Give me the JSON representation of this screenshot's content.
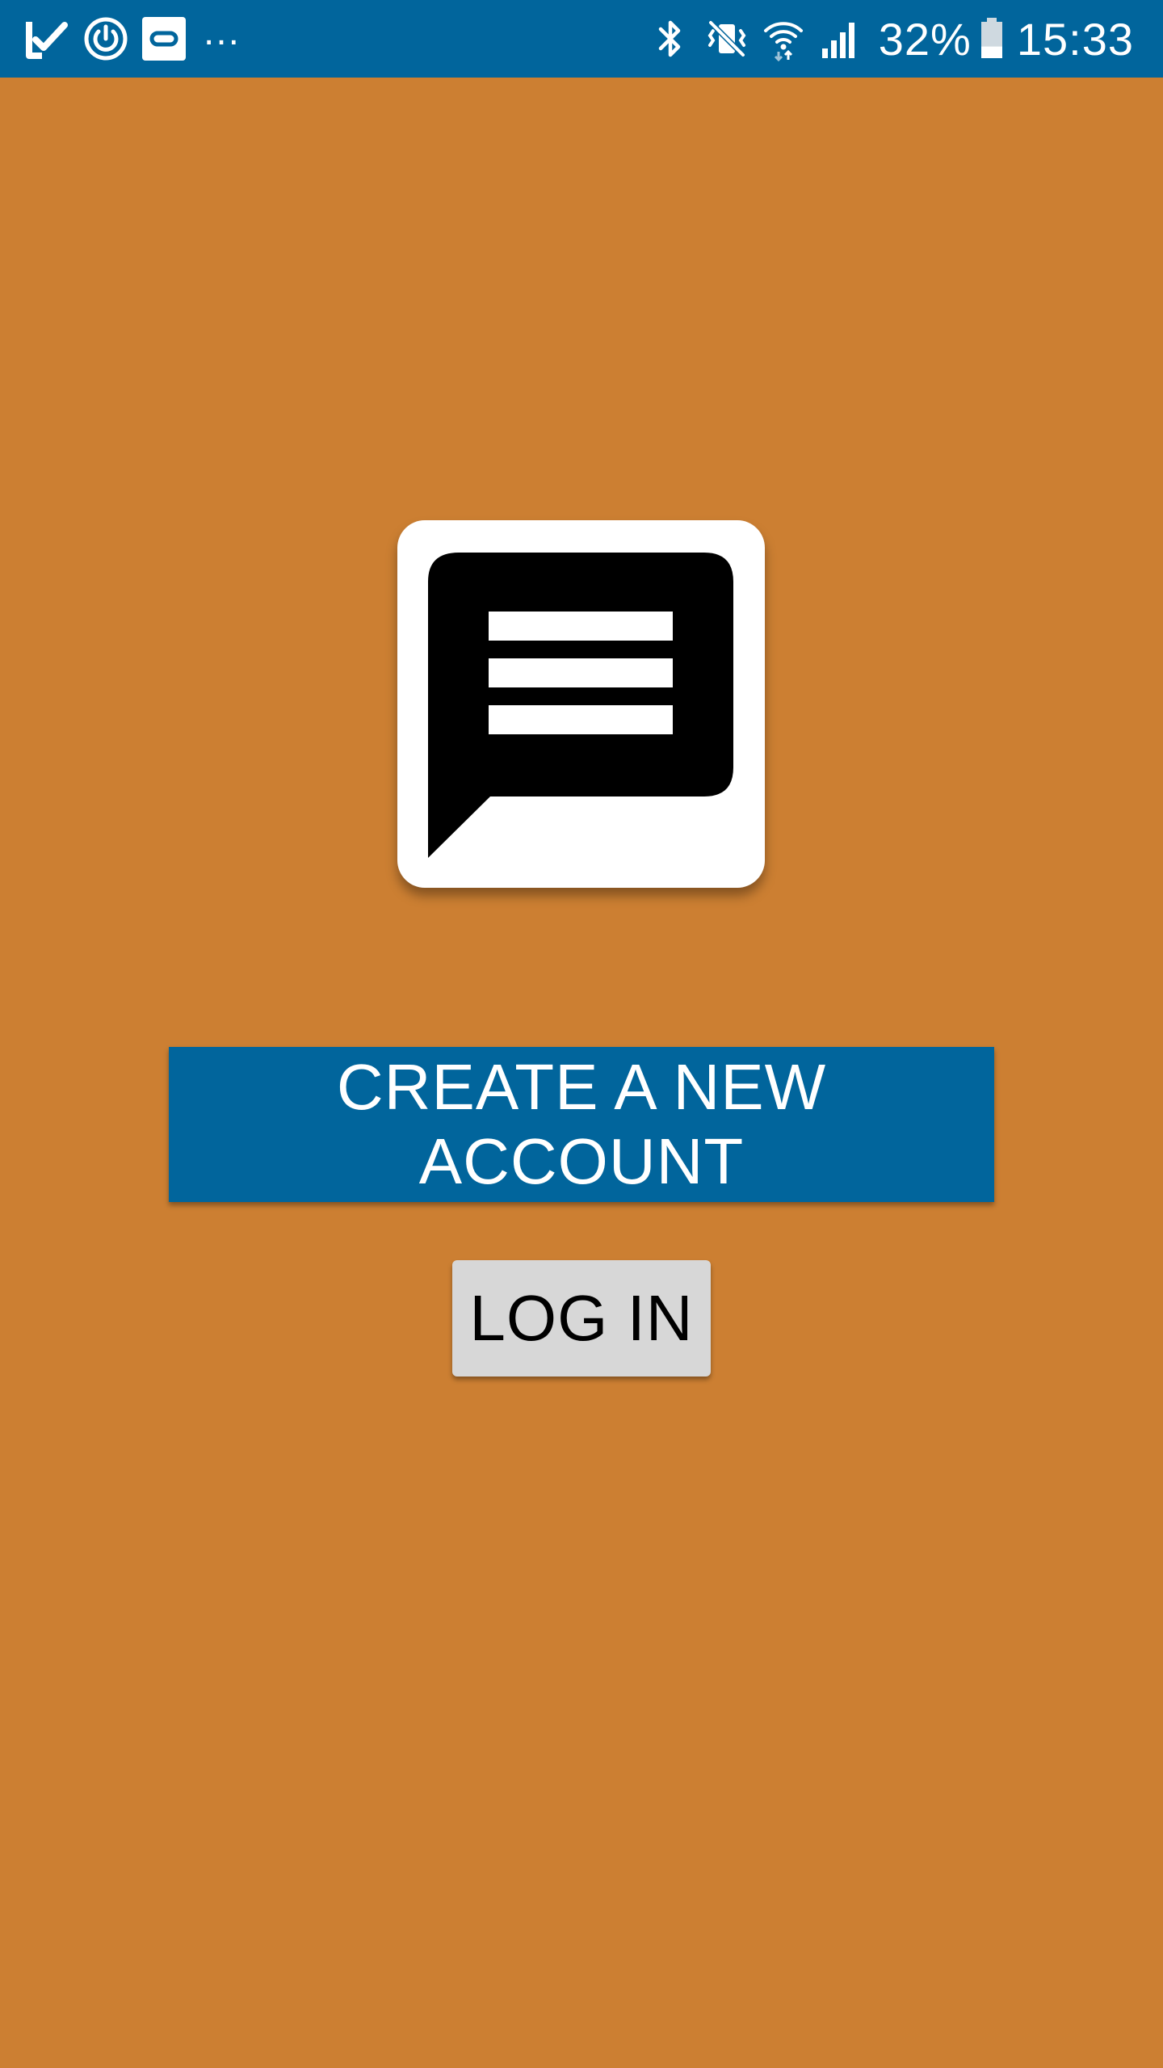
{
  "theme": {
    "background": "#CC7F32",
    "status_bar": "#01659C",
    "primary_button": "#01659C",
    "secondary_button": "#D7D7D7"
  },
  "status_bar": {
    "left_icons": [
      "check-notification-icon",
      "power-clock-icon",
      "app-notification-icon"
    ],
    "more_indicator": "...",
    "right_icons": [
      "bluetooth-icon",
      "vibrate-mute-icon",
      "wifi-icon",
      "signal-icon",
      "battery-icon"
    ],
    "battery_percent": "32%",
    "battery_level": 0.32,
    "time": "15:33"
  },
  "app": {
    "logo_icon": "chat-bubble-icon"
  },
  "actions": {
    "create_account_label": "CREATE A NEW ACCOUNT",
    "login_label": "LOG IN"
  }
}
